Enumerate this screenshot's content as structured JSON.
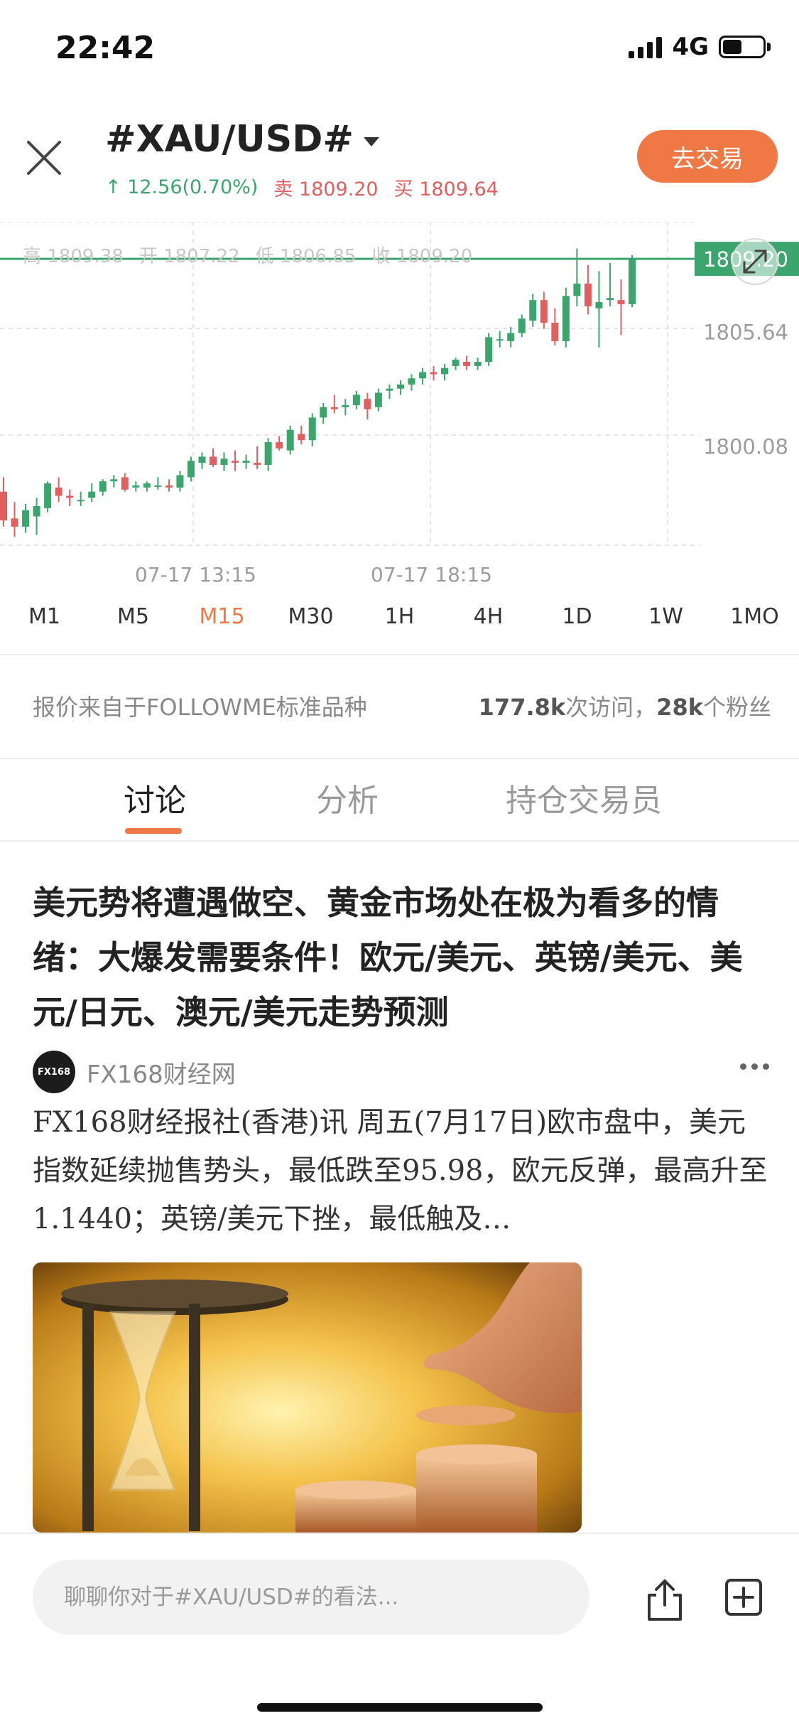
{
  "status_bar": {
    "time": "22:42",
    "network": "4G"
  },
  "header": {
    "symbol": "#XAU/USD#",
    "change": "↑ 12.56(0.70%)",
    "sell_label": "卖",
    "sell_price": "1809.20",
    "buy_label": "买",
    "buy_price": "1809.64",
    "trade_button": "去交易"
  },
  "chart_data": {
    "type": "candlestick",
    "ohlc_summary": {
      "high_label": "高",
      "high": "1809.38",
      "open_label": "开",
      "open": "1807.22",
      "low_label": "低",
      "low": "1806.85",
      "close_label": "收",
      "close": "1809.20"
    },
    "current_price": "1809.20",
    "y_ticks": [
      "1805.64",
      "1800.08"
    ],
    "x_ticks": [
      "07-17 13:15",
      "07-17 18:15"
    ],
    "ylim": [
      1795.3,
      1811.0
    ],
    "candles": [
      {
        "o": 1797.9,
        "h": 1798.6,
        "l": 1796.2,
        "c": 1796.5
      },
      {
        "o": 1796.6,
        "h": 1797.4,
        "l": 1795.7,
        "c": 1796.2
      },
      {
        "o": 1796.2,
        "h": 1797.3,
        "l": 1795.9,
        "c": 1797.0
      },
      {
        "o": 1796.7,
        "h": 1797.6,
        "l": 1795.8,
        "c": 1797.2
      },
      {
        "o": 1797.1,
        "h": 1798.4,
        "l": 1796.9,
        "c": 1798.3
      },
      {
        "o": 1798.1,
        "h": 1798.6,
        "l": 1797.4,
        "c": 1797.7
      },
      {
        "o": 1797.7,
        "h": 1798.0,
        "l": 1797.2,
        "c": 1797.6
      },
      {
        "o": 1797.5,
        "h": 1797.9,
        "l": 1797.2,
        "c": 1797.5
      },
      {
        "o": 1797.6,
        "h": 1798.3,
        "l": 1797.4,
        "c": 1797.9
      },
      {
        "o": 1797.9,
        "h": 1798.5,
        "l": 1797.7,
        "c": 1798.4
      },
      {
        "o": 1798.4,
        "h": 1798.7,
        "l": 1798.1,
        "c": 1798.5
      },
      {
        "o": 1798.6,
        "h": 1798.8,
        "l": 1797.9,
        "c": 1798.0
      },
      {
        "o": 1798.1,
        "h": 1798.4,
        "l": 1797.9,
        "c": 1798.2
      },
      {
        "o": 1798.1,
        "h": 1798.4,
        "l": 1797.9,
        "c": 1798.3
      },
      {
        "o": 1798.2,
        "h": 1798.6,
        "l": 1798.0,
        "c": 1798.2
      },
      {
        "o": 1798.2,
        "h": 1798.5,
        "l": 1797.9,
        "c": 1798.1
      },
      {
        "o": 1798.1,
        "h": 1798.9,
        "l": 1797.9,
        "c": 1798.7
      },
      {
        "o": 1798.6,
        "h": 1799.6,
        "l": 1798.4,
        "c": 1799.4
      },
      {
        "o": 1799.3,
        "h": 1799.8,
        "l": 1799.0,
        "c": 1799.6
      },
      {
        "o": 1799.6,
        "h": 1800.0,
        "l": 1799.1,
        "c": 1799.2
      },
      {
        "o": 1799.2,
        "h": 1799.8,
        "l": 1798.9,
        "c": 1799.5
      },
      {
        "o": 1799.4,
        "h": 1799.9,
        "l": 1798.9,
        "c": 1799.3
      },
      {
        "o": 1799.3,
        "h": 1799.7,
        "l": 1799.0,
        "c": 1799.4
      },
      {
        "o": 1799.3,
        "h": 1800.1,
        "l": 1799.0,
        "c": 1799.2
      },
      {
        "o": 1799.2,
        "h": 1800.5,
        "l": 1798.9,
        "c": 1800.3
      },
      {
        "o": 1800.3,
        "h": 1800.6,
        "l": 1799.9,
        "c": 1800.0
      },
      {
        "o": 1799.9,
        "h": 1801.1,
        "l": 1799.7,
        "c": 1800.9
      },
      {
        "o": 1800.7,
        "h": 1801.1,
        "l": 1800.2,
        "c": 1800.4
      },
      {
        "o": 1800.4,
        "h": 1801.7,
        "l": 1800.1,
        "c": 1801.5
      },
      {
        "o": 1801.5,
        "h": 1802.2,
        "l": 1801.2,
        "c": 1802.0
      },
      {
        "o": 1802.0,
        "h": 1802.6,
        "l": 1801.7,
        "c": 1801.9
      },
      {
        "o": 1802.0,
        "h": 1802.4,
        "l": 1801.6,
        "c": 1802.1
      },
      {
        "o": 1802.1,
        "h": 1802.8,
        "l": 1801.9,
        "c": 1802.6
      },
      {
        "o": 1802.4,
        "h": 1802.7,
        "l": 1801.4,
        "c": 1801.9
      },
      {
        "o": 1802.0,
        "h": 1802.9,
        "l": 1801.8,
        "c": 1802.7
      },
      {
        "o": 1802.8,
        "h": 1803.1,
        "l": 1802.4,
        "c": 1802.9
      },
      {
        "o": 1802.9,
        "h": 1803.3,
        "l": 1802.6,
        "c": 1803.1
      },
      {
        "o": 1803.1,
        "h": 1803.6,
        "l": 1802.8,
        "c": 1803.4
      },
      {
        "o": 1803.4,
        "h": 1803.9,
        "l": 1803.1,
        "c": 1803.7
      },
      {
        "o": 1803.7,
        "h": 1804.0,
        "l": 1803.3,
        "c": 1803.6
      },
      {
        "o": 1803.6,
        "h": 1804.1,
        "l": 1803.3,
        "c": 1803.9
      },
      {
        "o": 1804.0,
        "h": 1804.4,
        "l": 1803.8,
        "c": 1804.3
      },
      {
        "o": 1804.2,
        "h": 1804.5,
        "l": 1803.8,
        "c": 1804.0
      },
      {
        "o": 1804.0,
        "h": 1804.4,
        "l": 1803.8,
        "c": 1804.2
      },
      {
        "o": 1804.2,
        "h": 1805.6,
        "l": 1804.0,
        "c": 1805.4
      },
      {
        "o": 1805.3,
        "h": 1805.7,
        "l": 1804.9,
        "c": 1805.3
      },
      {
        "o": 1805.2,
        "h": 1805.9,
        "l": 1804.9,
        "c": 1805.6
      },
      {
        "o": 1805.6,
        "h": 1806.5,
        "l": 1805.4,
        "c": 1806.3
      },
      {
        "o": 1806.2,
        "h": 1807.5,
        "l": 1805.9,
        "c": 1807.2
      },
      {
        "o": 1807.2,
        "h": 1807.6,
        "l": 1805.8,
        "c": 1806.1
      },
      {
        "o": 1806.1,
        "h": 1806.8,
        "l": 1805.0,
        "c": 1805.2
      },
      {
        "o": 1805.2,
        "h": 1807.8,
        "l": 1804.9,
        "c": 1807.4
      },
      {
        "o": 1807.4,
        "h": 1809.7,
        "l": 1806.9,
        "c": 1808.0
      },
      {
        "o": 1808.0,
        "h": 1808.9,
        "l": 1806.5,
        "c": 1806.9
      },
      {
        "o": 1806.8,
        "h": 1808.6,
        "l": 1804.9,
        "c": 1807.1
      },
      {
        "o": 1807.2,
        "h": 1809.0,
        "l": 1806.9,
        "c": 1807.3
      },
      {
        "o": 1807.2,
        "h": 1808.2,
        "l": 1805.5,
        "c": 1807.0
      },
      {
        "o": 1807.0,
        "h": 1809.38,
        "l": 1806.85,
        "c": 1809.2
      }
    ],
    "colors": {
      "up": "#3ba56d",
      "down": "#e06060",
      "price_line": "#3ba56d"
    }
  },
  "timeframes": [
    "M1",
    "M5",
    "M15",
    "M30",
    "1H",
    "4H",
    "1D",
    "1W",
    "1MO"
  ],
  "active_timeframe": "M15",
  "info": {
    "source": "报价来自于FOLLOWME标准品种",
    "visits": "177.8k",
    "visits_label": "次访问，",
    "fans": "28k",
    "fans_label": "个粉丝"
  },
  "tabs": [
    "讨论",
    "分析",
    "持仓交易员"
  ],
  "article": {
    "title": "美元势将遭遇做空、黄金市场处在极为看多的情绪：大爆发需要条件！欧元/美元、英镑/美元、美元/日元、澳元/美元走势预测",
    "author": "FX168财经网",
    "author_logo_text": "FX168",
    "body": "FX168财经报社(香港)讯 周五(7月17日)欧市盘中，美元指数延续抛售势头，最低跌至95.98，欧元反弹，最高升至1.1440；英镑/美元下挫，最低触及…"
  },
  "bottom": {
    "input_placeholder": "聊聊你对于#XAU/USD#的看法..."
  }
}
